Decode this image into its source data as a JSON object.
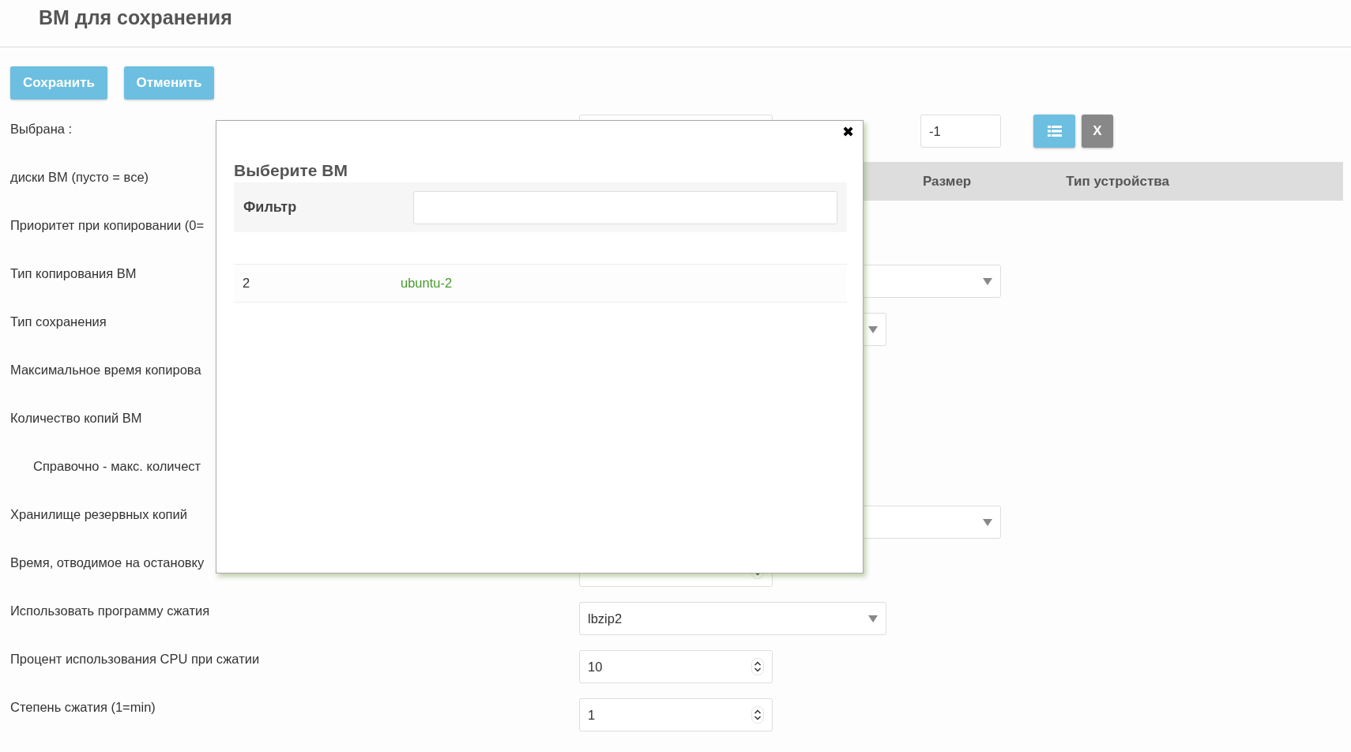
{
  "page": {
    "title": "ВМ для сохранения"
  },
  "toolbar": {
    "buttons": [
      {
        "label": "Сохранить"
      },
      {
        "label": "Отменить"
      }
    ]
  },
  "form": {
    "rows": [
      {
        "label": "Выбрана :",
        "kind": "vm-picker",
        "value": "-1",
        "clear_label": "X"
      },
      {
        "label": "диски ВМ (пусто = все)",
        "kind": "table",
        "columns": [
          "Размер",
          "Тип устройства"
        ]
      },
      {
        "label": "Приоритет при копировании (0=",
        "kind": "hidden"
      },
      {
        "label": "Тип копирования ВМ",
        "kind": "select-wide"
      },
      {
        "label": "Тип сохранения",
        "kind": "select"
      },
      {
        "label": "Максимальное время копирова",
        "kind": "hidden"
      },
      {
        "label": "Количество копий ВМ",
        "kind": "hidden"
      },
      {
        "label": "Справочно - макс. количест",
        "kind": "note"
      },
      {
        "label": "Хранилище резервных копий",
        "kind": "select-wide"
      },
      {
        "label": "Время, отводимое на остановку",
        "kind": "number"
      },
      {
        "label": "Использовать программу сжатия",
        "kind": "select",
        "value": "lbzip2"
      },
      {
        "label": "Процент использования CPU при сжатии",
        "kind": "number",
        "value": "10"
      },
      {
        "label": "Степень сжатия (1=min)",
        "kind": "number",
        "value": "1"
      }
    ]
  },
  "dialog": {
    "title": "Выберите ВМ",
    "close": "✖",
    "filter_label": "Фильтр",
    "rows": [
      {
        "number": "2",
        "name": "ubuntu-2"
      }
    ]
  }
}
